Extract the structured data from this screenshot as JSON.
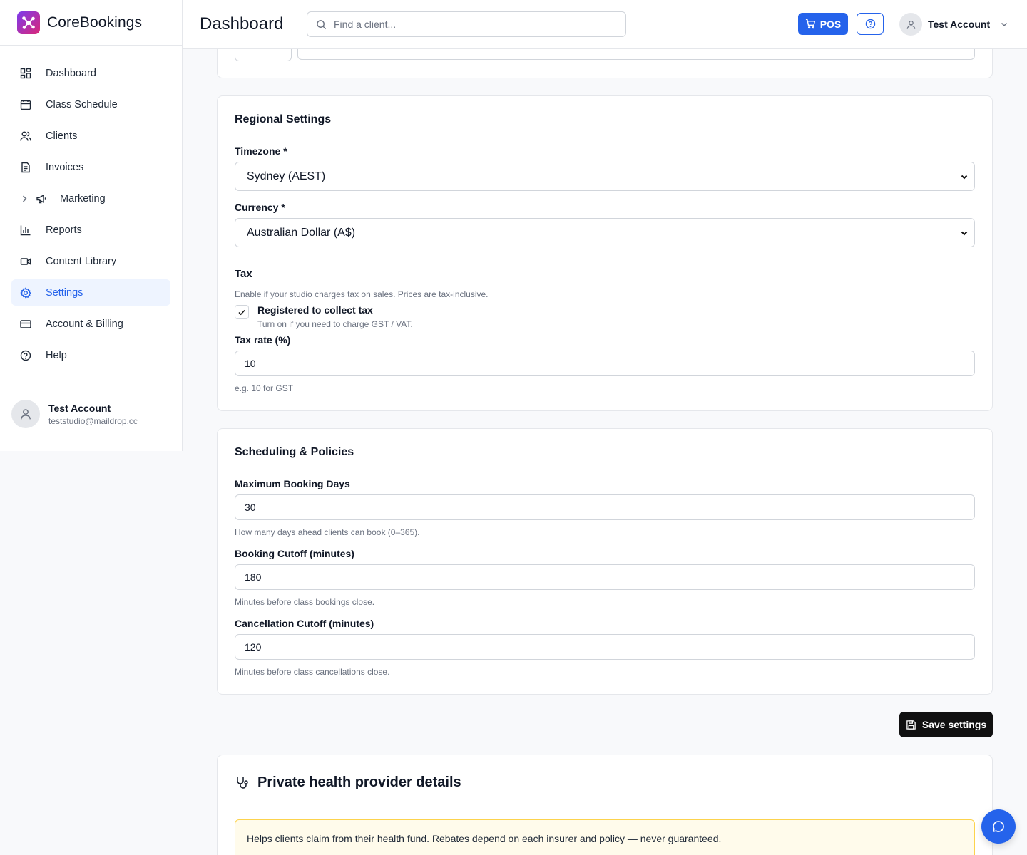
{
  "app": {
    "name": "CoreBookings"
  },
  "sidebar": {
    "items": [
      {
        "label": "Dashboard",
        "icon": "grid-icon"
      },
      {
        "label": "Class Schedule",
        "icon": "calendar-icon"
      },
      {
        "label": "Clients",
        "icon": "users-icon"
      },
      {
        "label": "Invoices",
        "icon": "file-icon"
      },
      {
        "label": "Marketing",
        "icon": "megaphone-icon"
      },
      {
        "label": "Reports",
        "icon": "bar-chart-icon"
      },
      {
        "label": "Content Library",
        "icon": "video-icon"
      },
      {
        "label": "Settings",
        "icon": "gear-icon",
        "active": true
      },
      {
        "label": "Account & Billing",
        "icon": "credit-card-icon"
      },
      {
        "label": "Help",
        "icon": "help-circle-icon"
      }
    ],
    "user": {
      "name": "Test Account",
      "email": "teststudio@maildrop.cc"
    }
  },
  "header": {
    "title": "Dashboard",
    "search_placeholder": "Find a client...",
    "pos_label": "POS",
    "user_name": "Test Account"
  },
  "regional": {
    "title": "Regional Settings",
    "timezone_label": "Timezone *",
    "timezone_value": "Sydney (AEST)",
    "currency_label": "Currency *",
    "currency_value": "Australian Dollar (A$)",
    "tax_title": "Tax",
    "tax_desc": "Enable if your studio charges tax on sales. Prices are tax-inclusive.",
    "tax_checkbox_label": "Registered to collect tax",
    "tax_checkbox_help": "Turn on if you need to charge GST / VAT.",
    "tax_checked": true,
    "tax_rate_label": "Tax rate (%)",
    "tax_rate_value": "10",
    "tax_rate_help": "e.g. 10 for GST"
  },
  "scheduling": {
    "title": "Scheduling & Policies",
    "max_days_label": "Maximum Booking Days",
    "max_days_value": "30",
    "max_days_help": "How many days ahead clients can book (0–365).",
    "booking_cutoff_label": "Booking Cutoff (minutes)",
    "booking_cutoff_value": "180",
    "booking_cutoff_help": "Minutes before class bookings close.",
    "cancel_cutoff_label": "Cancellation Cutoff (minutes)",
    "cancel_cutoff_value": "120",
    "cancel_cutoff_help": "Minutes before class cancellations close."
  },
  "save_label": "Save settings",
  "health": {
    "title": "Private health provider details",
    "notice": "Helps clients claim from their health fund. Rebates depend on each insurer and policy — never guaranteed."
  },
  "colors": {
    "accent": "#2563eb",
    "brand_start": "#7c3aed",
    "brand_end": "#db2777"
  }
}
